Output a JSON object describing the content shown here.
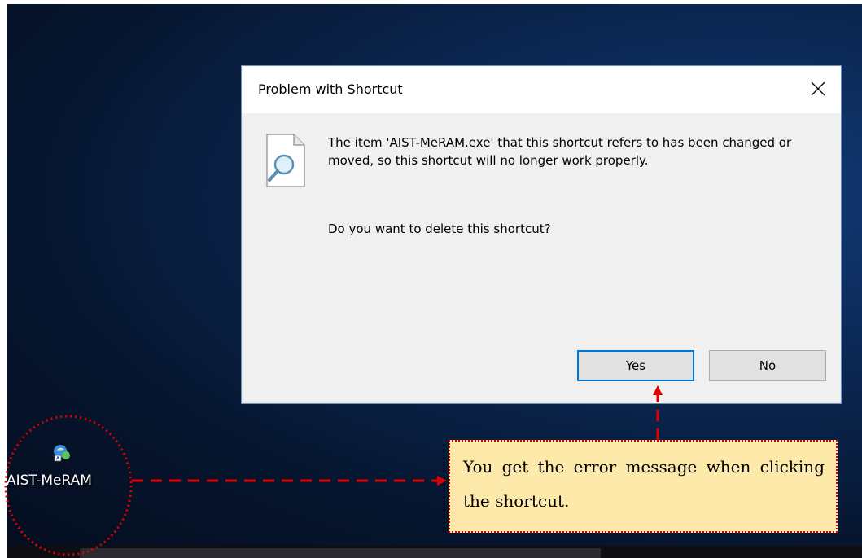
{
  "desktop": {
    "shortcut": {
      "label": "AIST-MeRAM",
      "icon": "app-shortcut-icon"
    }
  },
  "dialog": {
    "title": "Problem with Shortcut",
    "icon": "file-search-icon",
    "message": "The item 'AIST-MeRAM.exe' that this shortcut refers to has been changed or moved, so this shortcut will no longer work properly.",
    "question": "Do you want to delete this shortcut?",
    "buttons": {
      "yes": "Yes",
      "no": "No"
    },
    "close_glyph": "✕"
  },
  "annotation": {
    "text": "You get the error message when clicking the shortcut.",
    "colors": {
      "callout_bg": "#fde9a9",
      "arrow": "#e00000"
    }
  }
}
